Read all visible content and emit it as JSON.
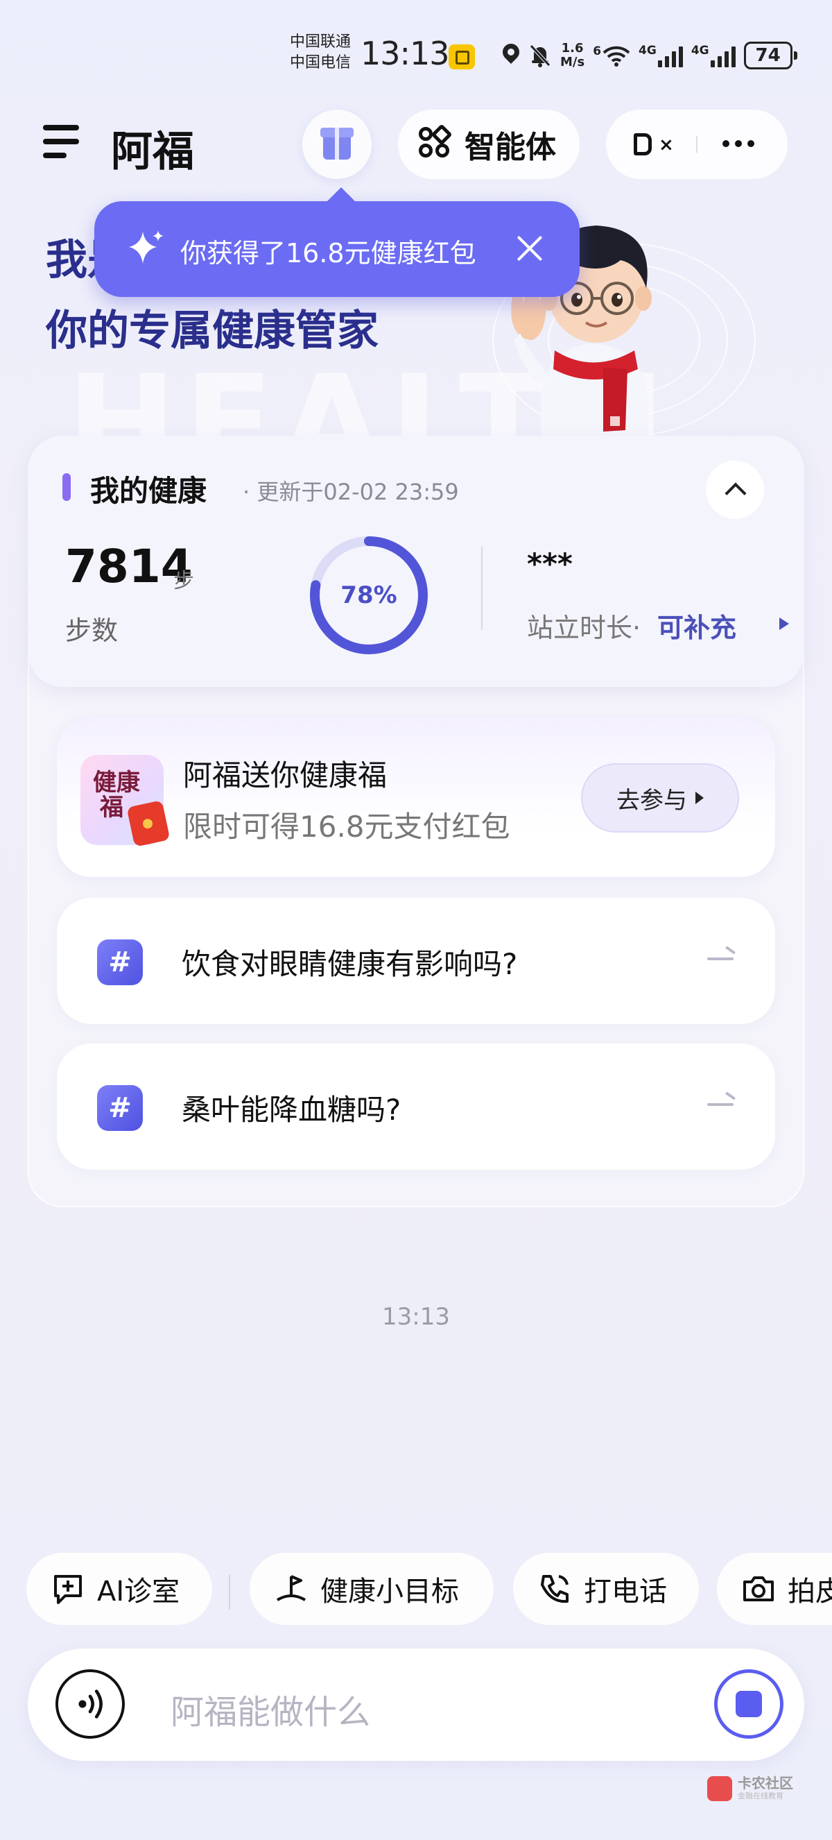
{
  "status_bar": {
    "carrier1": "中国联通",
    "carrier2": "中国电信",
    "time": "13:13",
    "speed_value": "1.6",
    "speed_unit": "M/s",
    "wifi_label": "6",
    "net1": "4G",
    "net2": "4G",
    "battery": "74"
  },
  "header": {
    "app_title": "阿福",
    "agent_label": "智能体"
  },
  "toast": {
    "text": "你获得了16.8元健康红包"
  },
  "hero": {
    "line1": "我是",
    "line2": "你的专属健康管家",
    "bg_word": "HEALTH"
  },
  "health": {
    "title": "我的健康",
    "updated": "· 更新于02-02 23:59",
    "steps_value": "7814",
    "steps_unit": "步",
    "steps_label": "步数",
    "progress_text": "78%",
    "progress": 0.78,
    "stand_value": "***",
    "stand_label": "站立时长·",
    "stand_link": "可补充"
  },
  "promo": {
    "img_text_1": "健康",
    "img_text_2": "福",
    "title": "阿福送你健康福",
    "subtitle": "限时可得16.8元支付红包",
    "button": "去参与"
  },
  "topics": [
    {
      "text": "饮食对眼睛健康有影响吗?"
    },
    {
      "text": "桑叶能降血糖吗?"
    }
  ],
  "timestamp": "13:13",
  "quick_actions": [
    {
      "label": "AI诊室",
      "icon": "chat-plus-icon"
    },
    {
      "label": "健康小目标",
      "icon": "target-flag-icon"
    },
    {
      "label": "打电话",
      "icon": "phone-icon"
    },
    {
      "label": "拍皮",
      "icon": "camera-icon"
    }
  ],
  "input": {
    "placeholder": "阿福能做什么"
  },
  "watermark": {
    "title": "卡农社区",
    "sub": "金融在线教育"
  },
  "colors": {
    "accent": "#6b6cf3",
    "hero_text": "#2a2f8c",
    "link": "#4b50b8"
  }
}
